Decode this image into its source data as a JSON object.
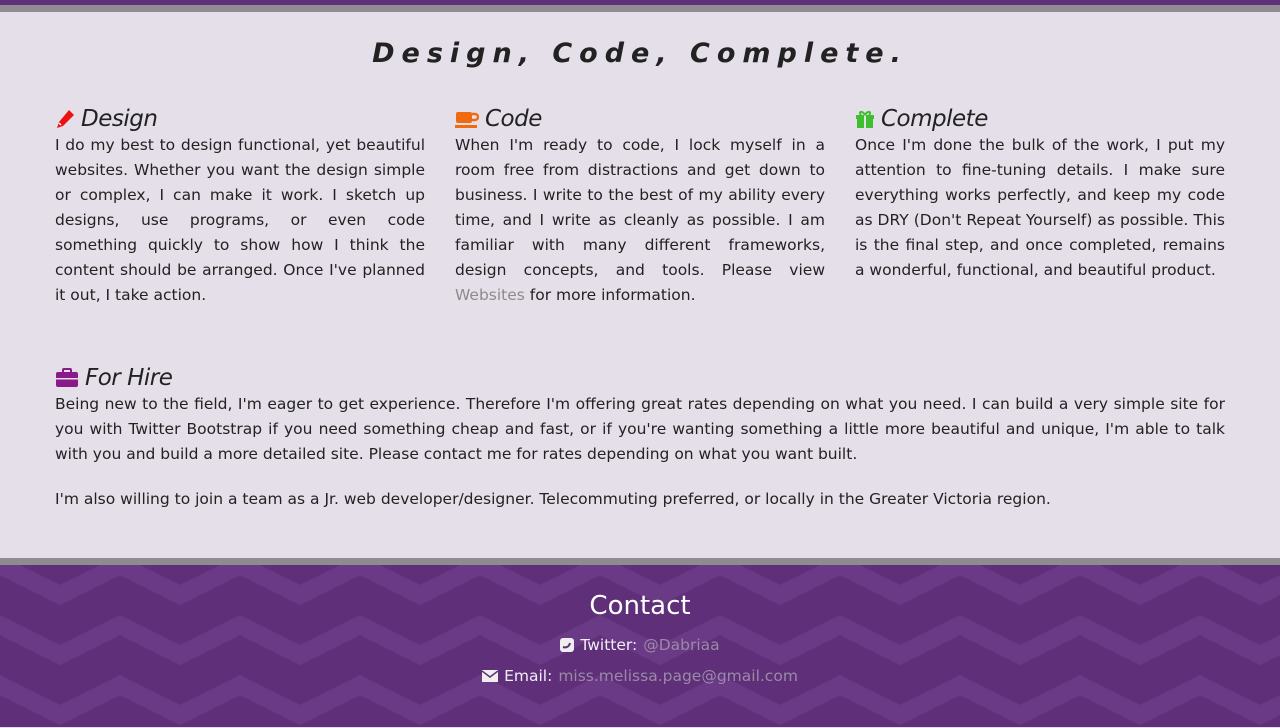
{
  "title": "Design, Code, Complete.",
  "columns": [
    {
      "icon": "pencil-icon",
      "color": "#ee1111",
      "heading": "Design",
      "text": "I do my best to design functional, yet beautiful websites. Whether you want the design simple or complex, I can make it work. I sketch up designs, use programs, or even code something quickly to show how I think the content should be arranged. Once I've planned it out, I take action."
    },
    {
      "icon": "coffee-icon",
      "color": "#f26a10",
      "heading": "Code",
      "text_before": "When I'm ready to code, I lock myself in a room free from distractions and get down to business. I write to the best of my ability every time, and I write as cleanly as possible. I am familiar with many different frameworks, design concepts, and tools. Please view ",
      "link": "Websites",
      "text_after": " for more information."
    },
    {
      "icon": "gift-icon",
      "color": "#3fbf2f",
      "heading": "Complete",
      "text": "Once I'm done the bulk of the work, I put my attention to fine-tuning details. I make sure everything works perfectly, and keep my code as DRY (Don't Repeat Yourself) as possible. This is the final step, and once completed, remains a wonderful, functional, and beautiful product."
    }
  ],
  "hire": {
    "icon": "briefcase-icon",
    "color": "#8a1a8a",
    "heading": "For Hire",
    "p1": "Being new to the field, I'm eager to get experience. Therefore I'm offering great rates depending on what you need. I can build a very simple site for you with Twitter Bootstrap if you need something cheap and fast, or if you're wanting something a little more beautiful and unique, I'm able to talk with you and build a more detailed site. Please contact me for rates depending on what you want built.",
    "p2": "I'm also willing to join a team as a Jr. web developer/designer. Telecommuting preferred, or locally in the Greater Victoria region."
  },
  "contact": {
    "heading": "Contact",
    "twitter_label": "Twitter:",
    "twitter": "@Dabriaa",
    "email_label": "Email:",
    "email": "miss.melissa.page@gmail.com"
  },
  "colors": {
    "purple": "#5f2f7a",
    "purple_light": "#6a3a86",
    "content_bg": "#e5dfe9",
    "divider": "#8e8c8e"
  }
}
